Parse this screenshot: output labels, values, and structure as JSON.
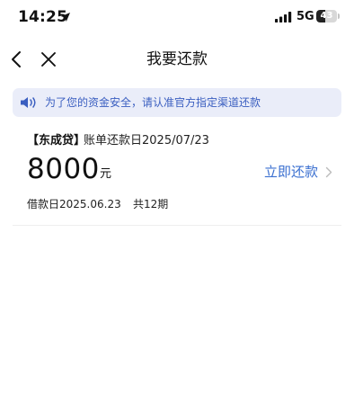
{
  "status_bar": {
    "time": "14:25",
    "network": "5G",
    "battery_level": "43",
    "battery_fraction": 0.43,
    "icons": [
      "location-arrow-icon",
      "signal-bars-icon",
      "battery-icon"
    ]
  },
  "nav": {
    "title": "我要还款",
    "back_icon": "chevron-left-icon",
    "close_icon": "close-icon"
  },
  "notice": {
    "icon": "speaker-icon",
    "text": "为了您的资金安全，请认准官方指定渠道还款"
  },
  "loan": {
    "lender": "【东成贷】",
    "due_label": "账单还款日",
    "due_date": "2025/07/23",
    "amount": "8000",
    "unit": "元",
    "action_label": "立即还款",
    "action_icon": "chevron-right-icon",
    "loan_date": "借款日2025.06.23",
    "periods": "共12期"
  },
  "colors": {
    "accent": "#3a6fd0",
    "banner_background": "#eaedf9",
    "banner_text": "#3a5ec0"
  }
}
